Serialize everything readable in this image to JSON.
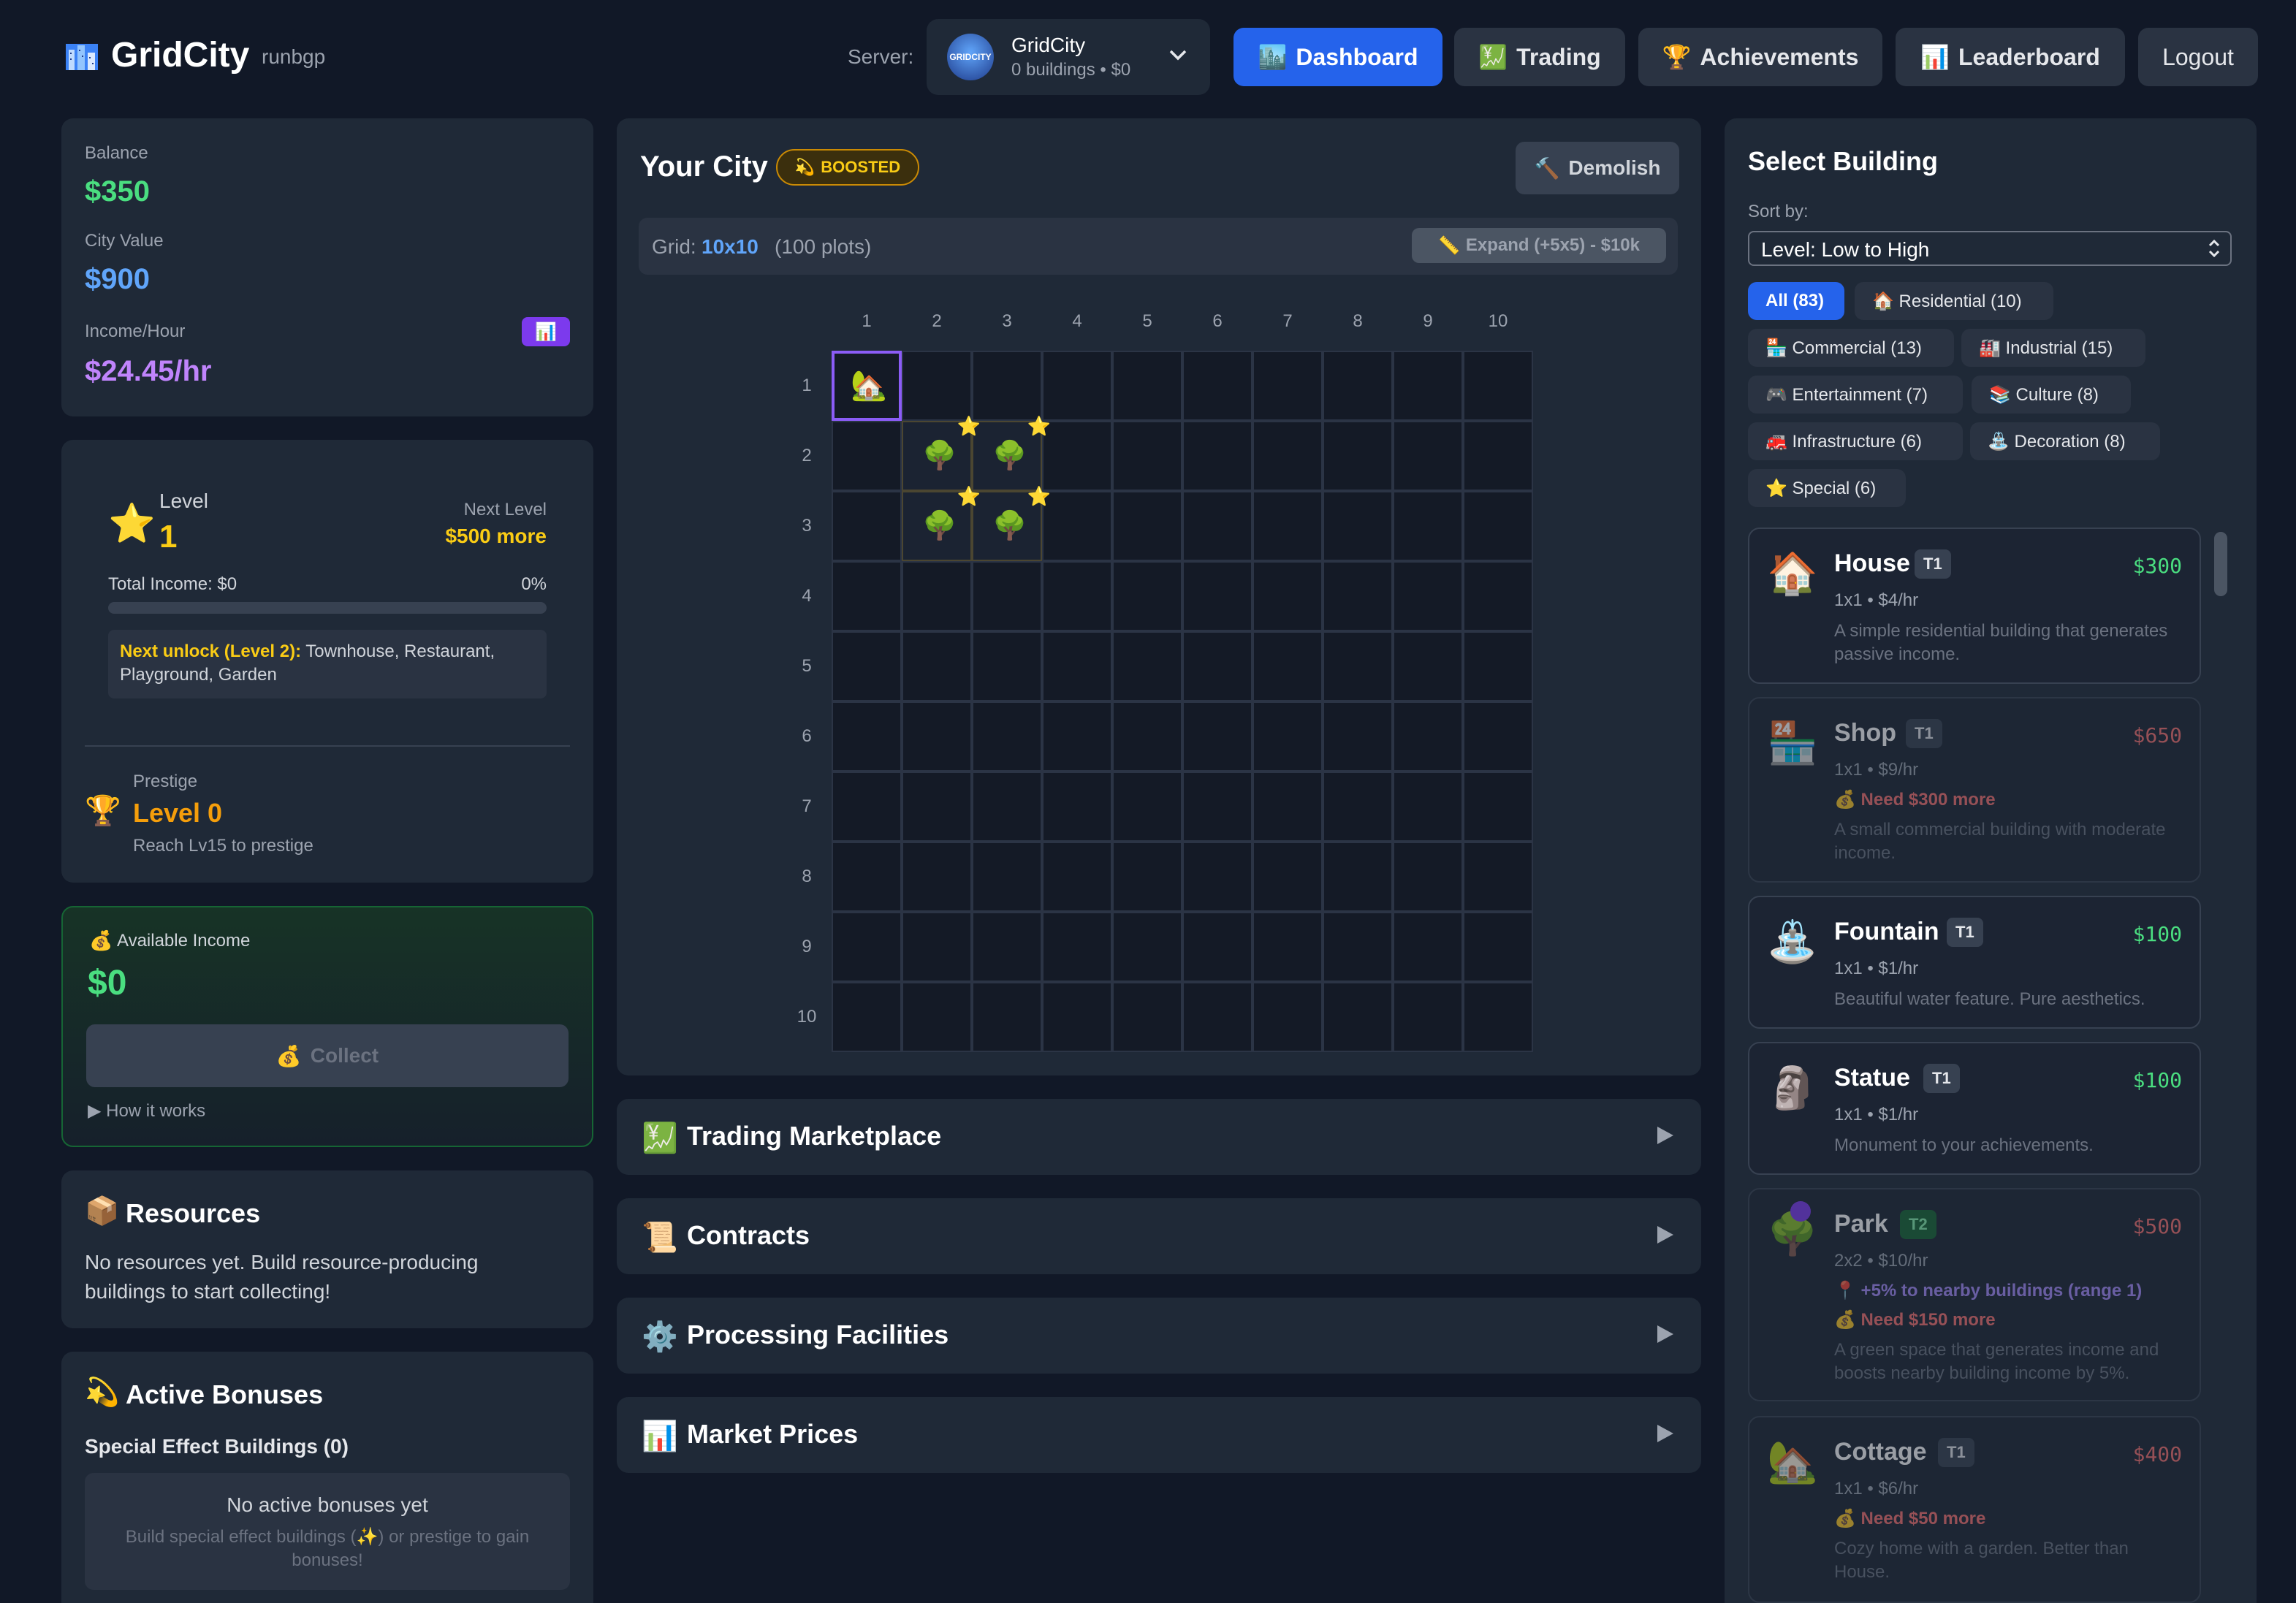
{
  "header": {
    "app_title": "GridCity",
    "username": "runbgp",
    "server_label": "Server:",
    "server": {
      "name": "GridCity",
      "subtitle": "0 buildings • $0",
      "avatar_text": "GRIDCITY"
    },
    "nav": {
      "dashboard": "Dashboard",
      "trading": "Trading",
      "achievements": "Achievements",
      "leaderboard": "Leaderboard",
      "logout": "Logout"
    }
  },
  "stats": {
    "balance_label": "Balance",
    "balance": "$350",
    "city_value_label": "City Value",
    "city_value": "$900",
    "income_label": "Income/Hour",
    "income": "$24.45/hr"
  },
  "level": {
    "label": "Level",
    "value": "1",
    "next_label": "Next Level",
    "next_value": "$500 more",
    "total_income": "Total Income: $0",
    "percent": "0%",
    "progress": 0,
    "unlock_label": "Next unlock (Level 2):",
    "unlock_text": " Townhouse, Restaurant, Playground, Garden",
    "prestige_label": "Prestige",
    "prestige_value": "Level 0",
    "prestige_note": "Reach Lv15 to prestige"
  },
  "income_box": {
    "label": "Available Income",
    "value": "$0",
    "collect": "Collect",
    "how": "▶ How it works"
  },
  "resources": {
    "title": "Resources",
    "text": "No resources yet. Build resource-producing buildings to start collecting!"
  },
  "bonuses": {
    "title": "Active Bonuses",
    "subtitle": "Special Effect Buildings (0)",
    "empty_title": "No active bonuses yet",
    "empty_text_1": "Build special effect buildings (✨) or prestige to gain",
    "empty_text_2": "bonuses!"
  },
  "city": {
    "title": "Your City",
    "badge": "BOOSTED",
    "demolish": "Demolish",
    "grid_label": "Grid:",
    "grid_size": "10x10",
    "grid_plots": "(100 plots)",
    "expand": "Expand (+5x5) - $10k",
    "cols": [
      "1",
      "2",
      "3",
      "4",
      "5",
      "6",
      "7",
      "8",
      "9",
      "10"
    ],
    "rows": [
      "1",
      "2",
      "3",
      "4",
      "5",
      "6",
      "7",
      "8",
      "9",
      "10"
    ]
  },
  "accordions": [
    {
      "icon": "💹",
      "title": "Trading Marketplace"
    },
    {
      "icon": "📜",
      "title": "Contracts"
    },
    {
      "icon": "⚙️",
      "title": "Processing Facilities"
    },
    {
      "icon": "📊",
      "title": "Market Prices"
    }
  ],
  "select": {
    "title": "Select Building",
    "sort_label": "Sort by:",
    "sort_value": "Level: Low to High",
    "filters": [
      "All (83)",
      "🏠 Residential (10)",
      "🏪 Commercial (13)",
      "🏭 Industrial (15)",
      "🎮 Entertainment (7)",
      "📚 Culture (8)",
      "🚒 Infrastructure (6)",
      "⛲ Decoration (8)",
      "⭐ Special (6)"
    ]
  },
  "buildings": [
    {
      "icon": "🏠",
      "name": "House",
      "tier": "T1",
      "price": "$300",
      "meta": "1x1 • $4/hr",
      "desc": "A simple residential building that generates passive income."
    },
    {
      "icon": "🏪",
      "name": "Shop",
      "tier": "T1",
      "price": "$650",
      "meta": "1x1 • $9/hr",
      "need": "💰 Need $300 more",
      "desc": "A small commercial building with moderate income."
    },
    {
      "icon": "⛲",
      "name": "Fountain",
      "tier": "T1",
      "price": "$100",
      "meta": "1x1 • $1/hr",
      "desc": "Beautiful water feature. Pure aesthetics."
    },
    {
      "icon": "🗿",
      "name": "Statue",
      "tier": "T1",
      "price": "$100",
      "meta": "1x1 • $1/hr",
      "desc": "Monument to your achievements."
    },
    {
      "icon": "🌳",
      "name": "Park",
      "tier": "T2",
      "price": "$500",
      "meta": "2x2 • $10/hr",
      "bonus": "📍 +5% to nearby buildings (range 1)",
      "need": "💰 Need $150 more",
      "desc": "A green space that generates income and boosts nearby building income by 5%."
    },
    {
      "icon": "🏡",
      "name": "Cottage",
      "tier": "T1",
      "price": "$400",
      "meta": "1x1 • $6/hr",
      "need": "💰 Need $50 more",
      "desc": "Cozy home with a garden. Better than House."
    }
  ],
  "colors": {
    "accent": "#2563eb",
    "balance": "#4ade80",
    "city_value": "#60a5fa",
    "income": "#c084fc",
    "gold": "#facc15",
    "prestige": "#f59e0b"
  }
}
